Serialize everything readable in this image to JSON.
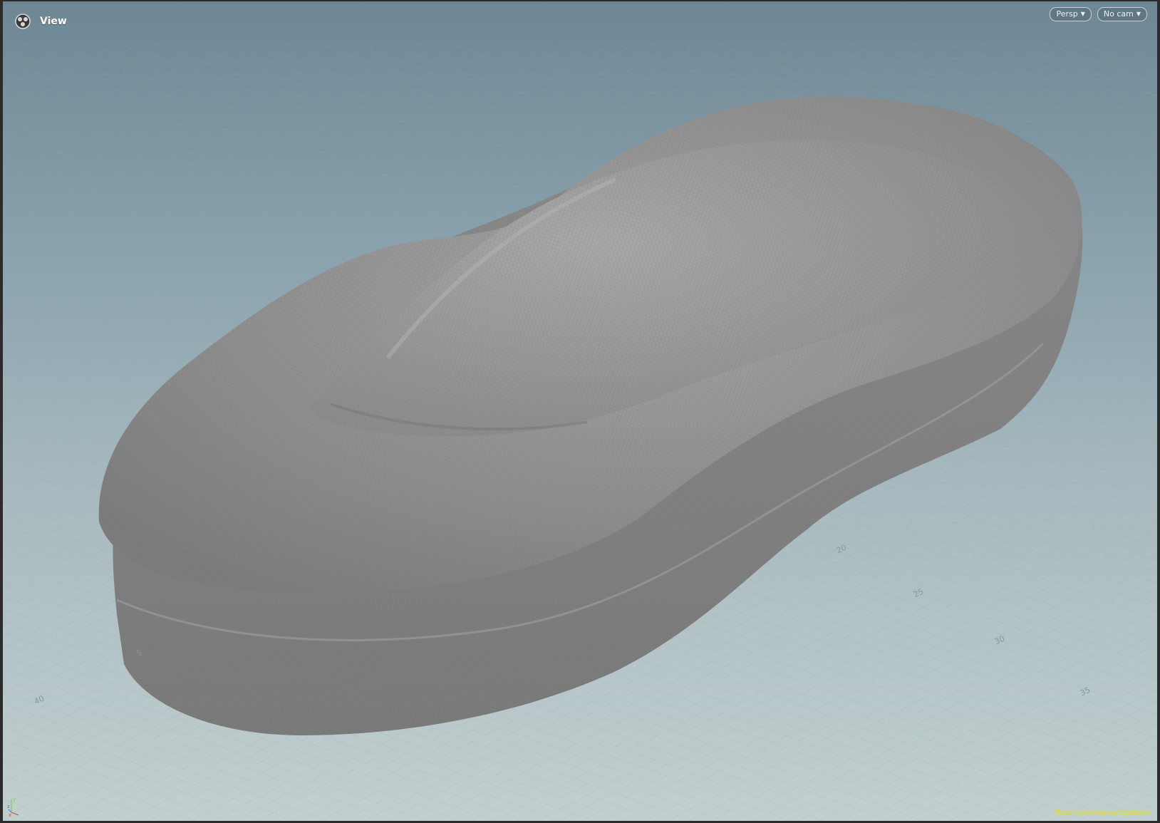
{
  "pane": {
    "title": "View",
    "icon": "viewer-icon"
  },
  "menus": {
    "view_mode": "Persp",
    "camera": "No cam"
  },
  "edition_label": "Non-Commercial Edition",
  "axis_labels": {
    "x": "x",
    "y": "y",
    "z": "z"
  },
  "grid_labels": [
    "20",
    "25",
    "30",
    "35",
    "40",
    "5"
  ],
  "colors": {
    "viewport_top": "#6e8794",
    "viewport_bottom": "#c2cfcf",
    "model": "#8f8f8f",
    "edition_text": "#e4e400"
  }
}
